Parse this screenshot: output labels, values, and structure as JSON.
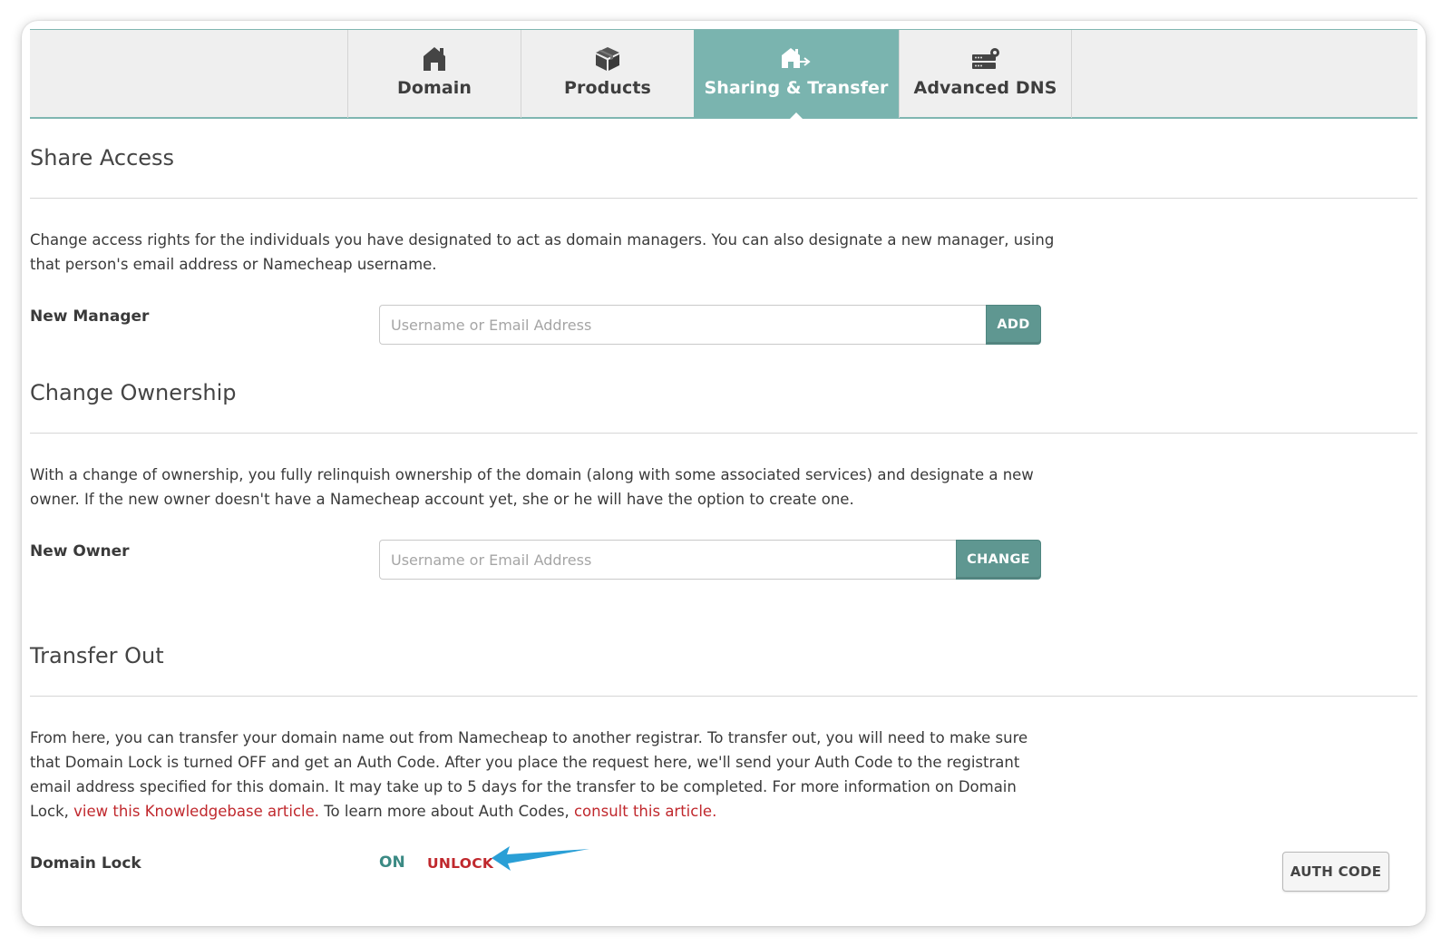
{
  "tabs": {
    "domain": {
      "label": "Domain",
      "icon": "house-icon"
    },
    "products": {
      "label": "Products",
      "icon": "box-icon"
    },
    "sharing": {
      "label": "Sharing & Transfer",
      "icon": "house-transfer-icon",
      "active": true
    },
    "dns": {
      "label": "Advanced DNS",
      "icon": "server-gear-icon"
    }
  },
  "share": {
    "title": "Share Access",
    "description": "Change access rights for the individuals you have designated to act as domain managers. You can also designate a new manager, using that person's email address or Namecheap username.",
    "label": "New Manager",
    "placeholder": "Username or Email Address",
    "value": "",
    "button": "ADD"
  },
  "ownership": {
    "title": "Change Ownership",
    "description": "With a change of ownership, you fully relinquish ownership of the domain (along with some associated services) and designate a new owner. If the new owner doesn't have a Namecheap account yet, she or he will have the option to create one.",
    "label": "New Owner",
    "placeholder": "Username or Email Address",
    "value": "",
    "button": "CHANGE"
  },
  "transfer": {
    "title": "Transfer Out",
    "description_part1": "From here, you can transfer your domain name out from Namecheap to another registrar. To transfer out, you will need to make sure that Domain Lock is turned OFF and get an Auth Code. After you place the request here, we'll send your Auth Code to the registrant email address specified for this domain. It may take up to 5 days for the transfer to be completed. For more information on Domain Lock, ",
    "link1": "view this Knowledgebase article.",
    "description_part2": " To learn more about Auth Codes, ",
    "link2": "consult this article.",
    "lock_label": "Domain Lock",
    "lock_status": "ON",
    "unlock_label": "UNLOCK",
    "auth_button": "AUTH CODE"
  },
  "colors": {
    "accent": "#7ab4af",
    "button": "#5f9791",
    "link": "#c0282d",
    "annotation_arrow": "#2a9fd6"
  }
}
